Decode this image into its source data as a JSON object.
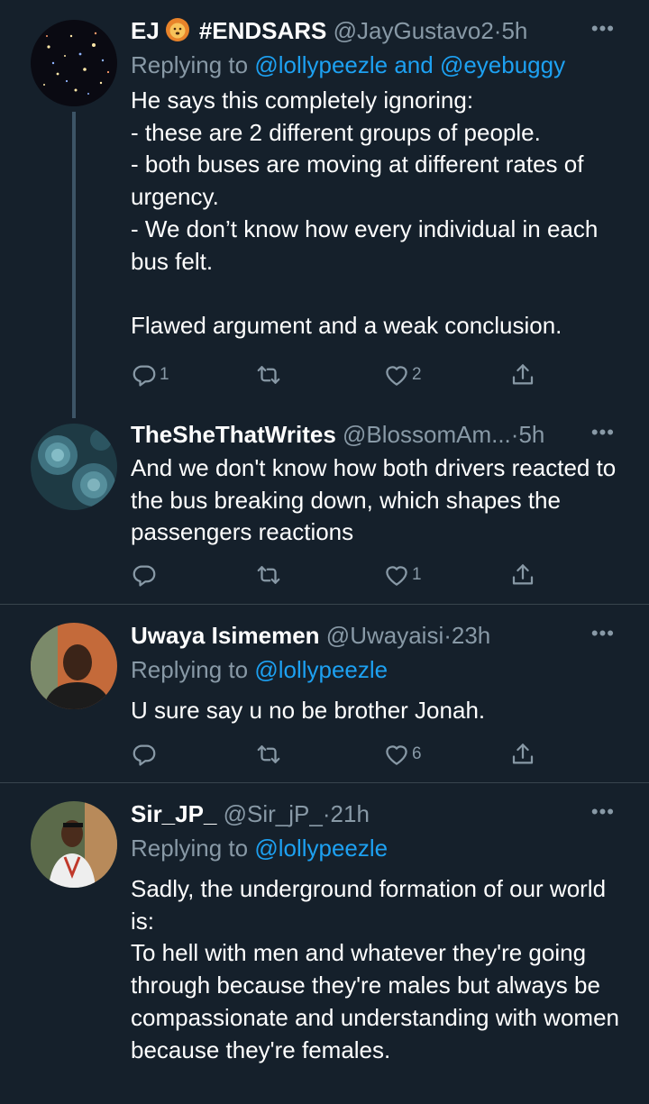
{
  "tweets": [
    {
      "name": "EJ",
      "badge_text": "#ENDSARS",
      "handle": "@JayGustavo2",
      "time": "5h",
      "replying_label": "Replying to",
      "replying_to": "@lollypeezle and @eyebuggy",
      "text": "He says this completely ignoring:\n- these are 2 different groups of people.\n- both buses are moving at different rates of urgency.\n- We don’t know how every individual in each bus felt.\n\nFlawed argument and a weak conclusion.",
      "reply_count": "1",
      "retweet_count": "",
      "like_count": "2"
    },
    {
      "name": "TheSheThatWrites",
      "handle": "@BlossomAm...",
      "time": "5h",
      "text": "And we don't know how both drivers reacted to the bus breaking down, which shapes the passengers reactions",
      "reply_count": "",
      "retweet_count": "",
      "like_count": "1"
    },
    {
      "name": "Uwaya Isimemen",
      "handle": "@Uwayaisi",
      "time": "23h",
      "replying_label": "Replying to",
      "replying_to": "@lollypeezle",
      "text": "U sure say u no be brother Jonah.",
      "reply_count": "",
      "retweet_count": "",
      "like_count": "6"
    },
    {
      "name": "Sir_JP_",
      "handle": "@Sir_jP_",
      "time": "21h",
      "replying_label": "Replying to",
      "replying_to": "@lollypeezle",
      "text": "Sadly, the underground formation of our world is:\nTo hell with men and whatever they're going through because they're males but always be compassionate and understanding with women because they're females."
    }
  ],
  "ui": {
    "separator": "·",
    "more": "•••"
  },
  "icons": {
    "reply": "reply-icon",
    "retweet": "retweet-icon",
    "like": "heart-icon",
    "share": "share-icon",
    "badge": "lion-emoji-icon"
  },
  "colors": {
    "background": "#15202b",
    "text": "#ffffff",
    "muted": "#8899a6",
    "link": "#1da1f2",
    "divider": "#38444d",
    "thread_line": "#3d5466"
  }
}
